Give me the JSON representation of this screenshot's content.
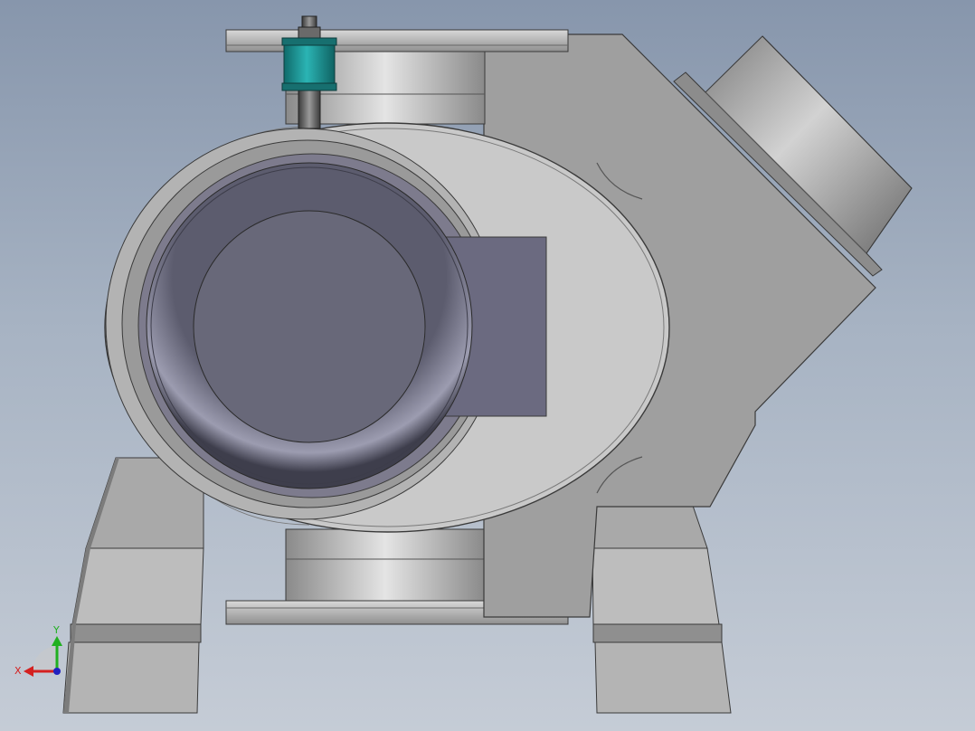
{
  "scene": {
    "colors": {
      "background_top": "#8796ac",
      "background_bottom": "#c5ccd6",
      "body": "#c4c4c4",
      "casting": "#9e9e9e",
      "bonnet_ring": "#7d7b8d",
      "ball_face": "#686879",
      "actuator_accent": "#1e9a9a"
    }
  },
  "triad": {
    "x_label": "X",
    "y_label": "Y",
    "x_color": "#d42020",
    "y_color": "#20b020",
    "z_color": "#2020c0"
  }
}
